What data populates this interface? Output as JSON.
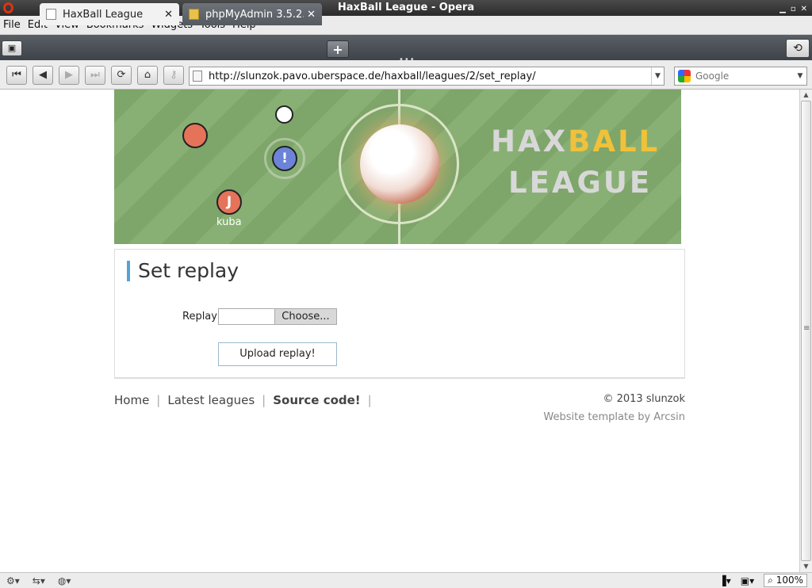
{
  "window": {
    "title": "HaxBall League - Opera"
  },
  "menu": [
    "File",
    "Edit",
    "View",
    "Bookmarks",
    "Widgets",
    "Tools",
    "Help"
  ],
  "tabs": [
    {
      "title": "HaxBall League"
    },
    {
      "title": "phpMyAdmin 3.5.2..."
    }
  ],
  "address": {
    "url": "http://slunzok.pavo.uberspace.de/haxball/leagues/2/set_replay/"
  },
  "search": {
    "placeholder": "Google"
  },
  "banner": {
    "player_initial_1": "!",
    "player_initial_2": "J",
    "player_name": "kuba",
    "logo_hax": "HAX",
    "logo_ball": "BALL",
    "logo_league": "LEAGUE"
  },
  "form": {
    "heading": "Set replay",
    "replay_label": "Replay",
    "choose_label": "Choose...",
    "upload_label": "Upload replay!"
  },
  "footer": {
    "nav": [
      "Home",
      "Latest leagues",
      "Source code!"
    ],
    "copyright": "© 2013 slunzok",
    "template": "Website template by Arcsin"
  },
  "status": {
    "zoom": "100%"
  }
}
